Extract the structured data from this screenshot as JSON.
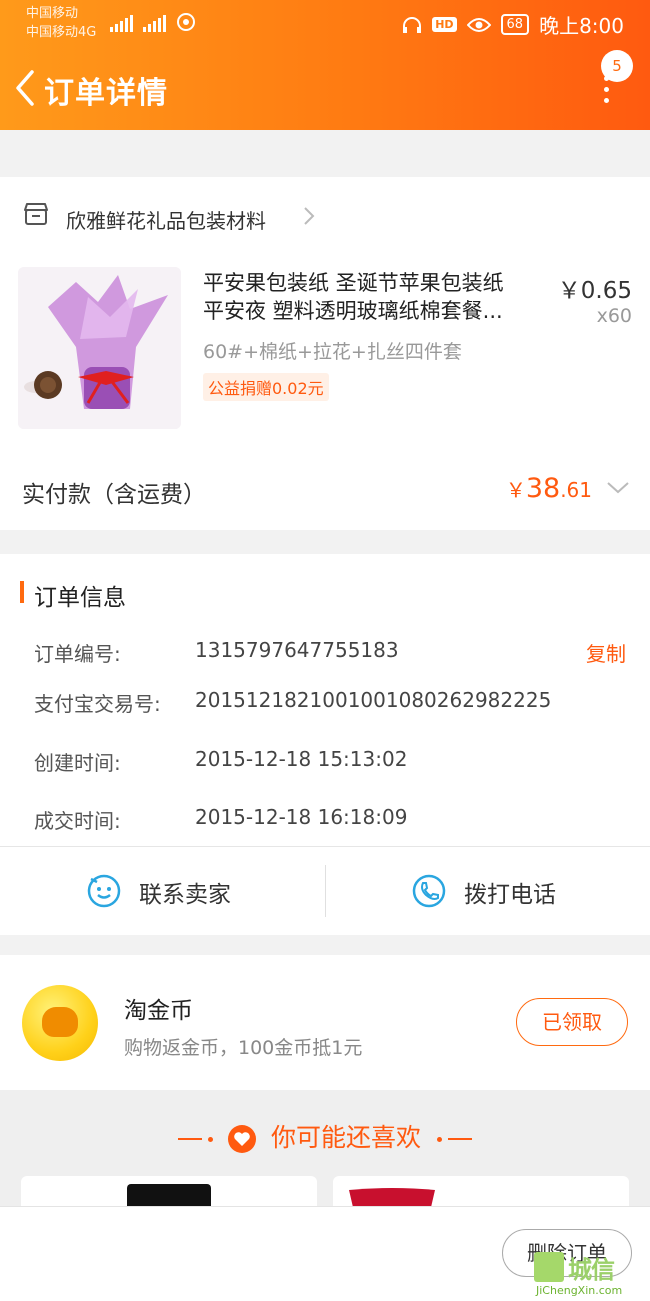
{
  "status_bar": {
    "carrier1": "中国移动",
    "carrier2": "中国移动4G",
    "battery": "68",
    "time": "晚上8:00"
  },
  "header": {
    "title": "订单详情",
    "badge_count": "5"
  },
  "shop": {
    "name": "欣雅鲜花礼品包装材料"
  },
  "product": {
    "title_line1": "平安果包装纸 圣诞节苹果包装纸",
    "title_line2": "平安夜 塑料透明玻璃纸棉套餐...",
    "price": "￥0.65",
    "quantity": "x60",
    "sku": "60#+棉纸+拉花+扎丝四件套",
    "charity_tag": "公益捐赠0.02元"
  },
  "payment": {
    "label": "实付款（含运费）",
    "currency": "￥",
    "amount_int": "38",
    "amount_dec": ".61"
  },
  "order_info": {
    "section_title": "订单信息",
    "rows": [
      {
        "key": "订单编号:",
        "value": "1315797647755183"
      },
      {
        "key": "支付宝交易号:",
        "value": "2015121821001001080262982225"
      },
      {
        "key": "创建时间:",
        "value": "2015-12-18 15:13:02"
      },
      {
        "key": "成交时间:",
        "value": "2015-12-18 16:18:09"
      }
    ],
    "copy_label": "复制"
  },
  "contact": {
    "seller_label": "联系卖家",
    "phone_label": "拨打电话"
  },
  "coins": {
    "title": "淘金币",
    "subtitle": "购物返金币，100金币抵1元",
    "button": "已领取"
  },
  "recommend": {
    "title": "你可能还喜欢"
  },
  "bottom": {
    "delete_button": "删除订单"
  },
  "watermark": {
    "cn": "城信",
    "en": "JiChengXin.com"
  },
  "colors": {
    "accent": "#ff5a10",
    "header_start": "#ff9a1a",
    "header_end": "#ff5a10",
    "contact_icon": "#2aa6e0"
  }
}
